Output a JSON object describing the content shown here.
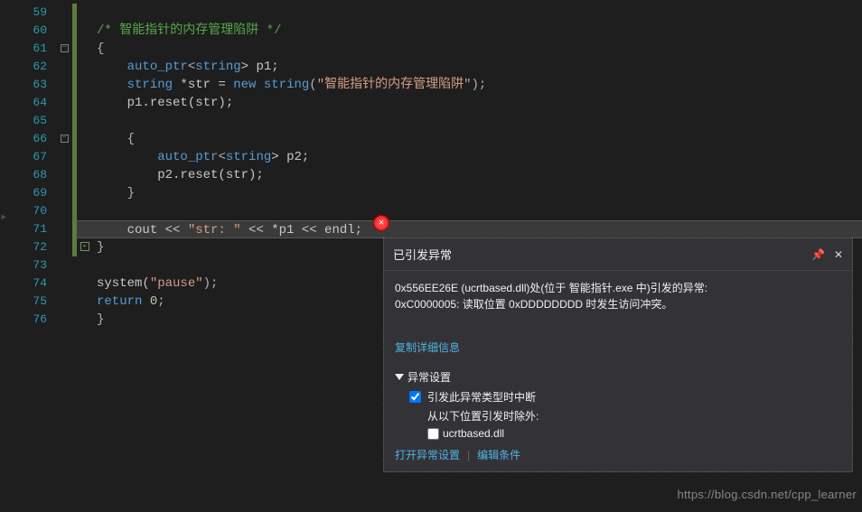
{
  "lineNumbers": [
    "59",
    "60",
    "61",
    "62",
    "63",
    "64",
    "65",
    "66",
    "67",
    "68",
    "69",
    "70",
    "71",
    "72",
    "73",
    "74",
    "75",
    "76"
  ],
  "code": {
    "commentText": "/* 智能指针的内存管理陷阱 */",
    "openBrace": "{",
    "line62": {
      "pre": "    ",
      "t1": "auto_ptr",
      "t2": "<",
      "t3": "string",
      "t4": "> p1;"
    },
    "line63": {
      "pre": "    ",
      "t1": "string",
      "t2": " *str = ",
      "kw": "new",
      "t3": " ",
      "t4": "string",
      "t5": "(",
      "str": "\"智能指针的内存管理陷阱\"",
      "t6": ");"
    },
    "line64": {
      "pre": "    ",
      "t1": "p1.reset(str);"
    },
    "line66": {
      "pre": "    ",
      "t1": "{"
    },
    "line67": {
      "pre": "        ",
      "t1": "auto_ptr",
      "t2": "<",
      "t3": "string",
      "t4": "> p2;"
    },
    "line68": {
      "pre": "        ",
      "t1": "p2.reset(str);"
    },
    "line69": {
      "pre": "    ",
      "t1": "}"
    },
    "line71": {
      "pre": "    ",
      "t1": "cout << ",
      "s1": "\"str: \"",
      "t2": " << *p1 << endl;"
    },
    "line72": {
      "t1": "}"
    },
    "line74": {
      "t1": "system(",
      "s1": "\"pause\"",
      "t2": ");"
    },
    "line75": {
      "t1": "return ",
      "n1": "0",
      "t2": ";"
    },
    "line76": {
      "t1": "}"
    }
  },
  "popup": {
    "title": "已引发异常",
    "message1": "0x556EE26E (ucrtbased.dll)处(位于 智能指针.exe 中)引发的异常:",
    "message2": "0xC0000005: 读取位置 0xDDDDDDDD 时发生访问冲突。",
    "copyLink": "复制详细信息",
    "settingsLabel": "异常设置",
    "check1": "引发此异常类型时中断",
    "subLabel": "从以下位置引发时除外:",
    "check2": "ucrtbased.dll",
    "footerLink1": "打开异常设置",
    "footerLink2": "编辑条件",
    "check1_checked": true,
    "check2_checked": false
  },
  "watermark": "https://blog.csdn.net/cpp_learner"
}
